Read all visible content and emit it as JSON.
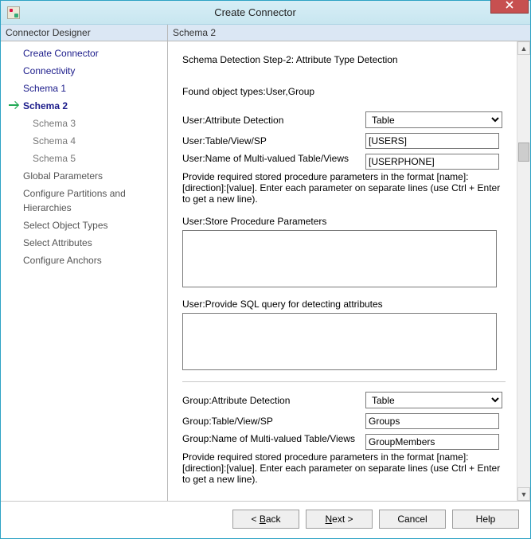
{
  "window": {
    "title": "Create Connector"
  },
  "sidebar": {
    "header": "Connector Designer",
    "items": [
      {
        "label": "Create Connector",
        "type": "link"
      },
      {
        "label": "Connectivity",
        "type": "link"
      },
      {
        "label": "Schema 1",
        "type": "link"
      },
      {
        "label": "Schema 2",
        "type": "active"
      },
      {
        "label": "Schema 3",
        "type": "sub"
      },
      {
        "label": "Schema 4",
        "type": "sub"
      },
      {
        "label": "Schema 5",
        "type": "sub"
      },
      {
        "label": "Global Parameters",
        "type": "plain"
      },
      {
        "label": "Configure Partitions and Hierarchies",
        "type": "plain"
      },
      {
        "label": "Select Object Types",
        "type": "plain"
      },
      {
        "label": "Select Attributes",
        "type": "plain"
      },
      {
        "label": "Configure Anchors",
        "type": "plain"
      }
    ]
  },
  "content": {
    "header": "Schema 2",
    "step_title": "Schema Detection Step-2: Attribute Type Detection",
    "found_types": "Found object types:User,Group",
    "user": {
      "attr_detection_label": "User:Attribute Detection",
      "attr_detection_value": "Table",
      "table_label": "User:Table/View/SP",
      "table_value": "[USERS]",
      "multi_label": "User:Name of Multi-valued Table/Views",
      "multi_value": "[USERPHONE]",
      "hint": "Provide required stored procedure parameters in the format [name]:[direction]:[value]. Enter each parameter on separate lines (use Ctrl + Enter to get a new line).",
      "sp_params_label": "User:Store Procedure Parameters",
      "sp_params_value": "",
      "sql_label": "User:Provide SQL query for detecting attributes",
      "sql_value": ""
    },
    "group": {
      "attr_detection_label": "Group:Attribute Detection",
      "attr_detection_value": "Table",
      "table_label": "Group:Table/View/SP",
      "table_value": "Groups",
      "multi_label": "Group:Name of Multi-valued Table/Views",
      "multi_value": "GroupMembers",
      "hint": "Provide required stored procedure parameters in the format [name]:[direction]:[value]. Enter each parameter on separate lines (use Ctrl + Enter to get a new line)."
    }
  },
  "footer": {
    "back": "Back",
    "next": "Next",
    "cancel": "Cancel",
    "help": "Help"
  }
}
